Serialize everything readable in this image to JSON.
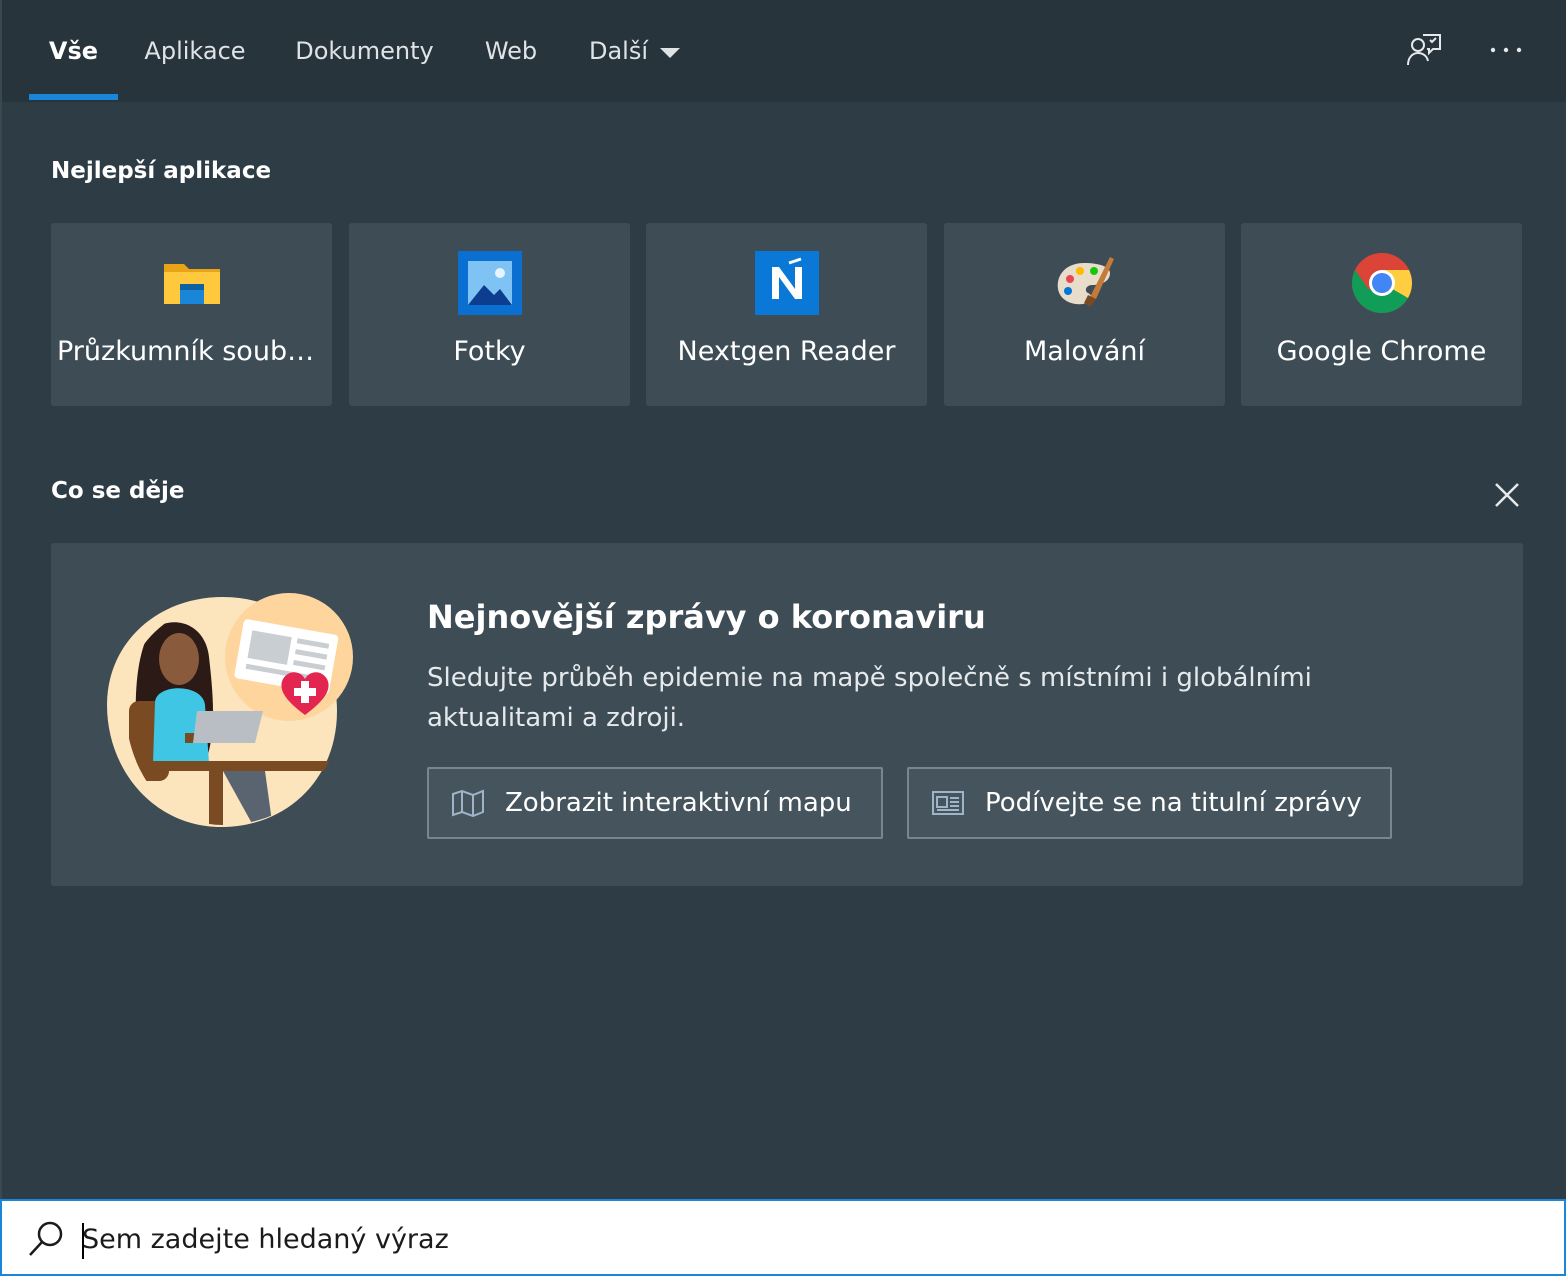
{
  "tabs": {
    "all": "Vše",
    "apps": "Aplikace",
    "documents": "Dokumenty",
    "web": "Web",
    "more": "Další"
  },
  "sections": {
    "top_apps": "Nejlepší aplikace",
    "whats_happening": "Co se děje"
  },
  "apps": [
    {
      "label": "Průzkumník souborů",
      "icon": "file-explorer-icon"
    },
    {
      "label": "Fotky",
      "icon": "photos-icon"
    },
    {
      "label": "Nextgen Reader",
      "icon": "nextgen-reader-icon"
    },
    {
      "label": "Malování",
      "icon": "paint-icon"
    },
    {
      "label": "Google Chrome",
      "icon": "chrome-icon"
    }
  ],
  "news": {
    "headline": "Nejnovější zprávy o koronaviru",
    "body": "Sledujte průběh epidemie na mapě společně s místními i globálními aktualitami a zdroji.",
    "map_button": "Zobrazit interaktivní mapu",
    "headlines_button": "Podívejte se na titulní zprávy"
  },
  "search": {
    "placeholder": "Sem zadejte hledaný výraz"
  },
  "colors": {
    "accent": "#1a86d9",
    "panel": "#2e3c45",
    "tile": "#3e4c55"
  }
}
